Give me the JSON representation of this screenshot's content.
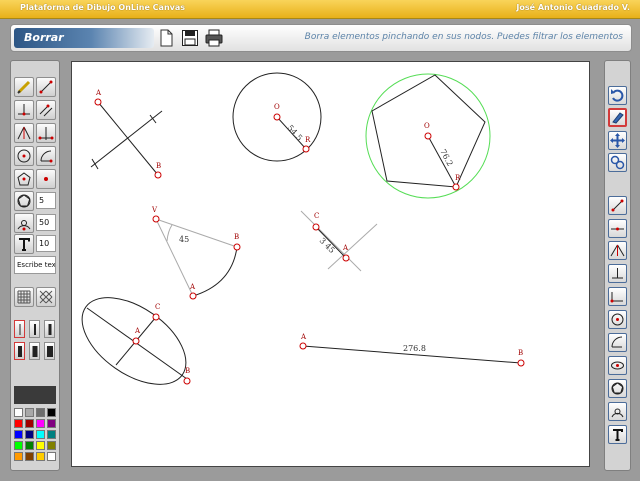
{
  "titlebar": {
    "title": "Plataforma de Dibujo OnLine Canvas",
    "author": "José Antonio Cuadrado V."
  },
  "header": {
    "mode_label": "Borrar",
    "hint": "Borra elementos pinchando en sus nodos. Puedes filtrar los elementos"
  },
  "left_toolbar": {
    "polygon_sides": "5",
    "circle_size": "50",
    "font_size": "10",
    "text_value": "Escribe texto",
    "colors": [
      "#ffffff",
      "#a8a8a8",
      "#6e6e6e",
      "#000000",
      "#ff0000",
      "#a00000",
      "#ff00ff",
      "#800080",
      "#0000ff",
      "#000080",
      "#00ffff",
      "#008080",
      "#00ff00",
      "#008000",
      "#ffff00",
      "#808000",
      "#ff9900",
      "#804000",
      "#ffcc00",
      "#ffffff"
    ]
  },
  "canvas": {
    "labels": {
      "a1": "A",
      "b1": "B",
      "o_circle": "O",
      "r_circle": "R",
      "circle_measure": "54.5",
      "o_poly": "O",
      "r_poly": "R",
      "poly_measure": "76.2",
      "v_angle": "V",
      "b_angle": "B",
      "a_angle": "A",
      "angle_measure": "45",
      "c_perp": "C",
      "a_perp": "A",
      "perp_measure": "3 45",
      "c_ellipse": "C",
      "a_ellipse": "A",
      "b_ellipse": "B",
      "a_segment": "A",
      "b_segment": "B",
      "segment_measure": "276.8"
    }
  }
}
